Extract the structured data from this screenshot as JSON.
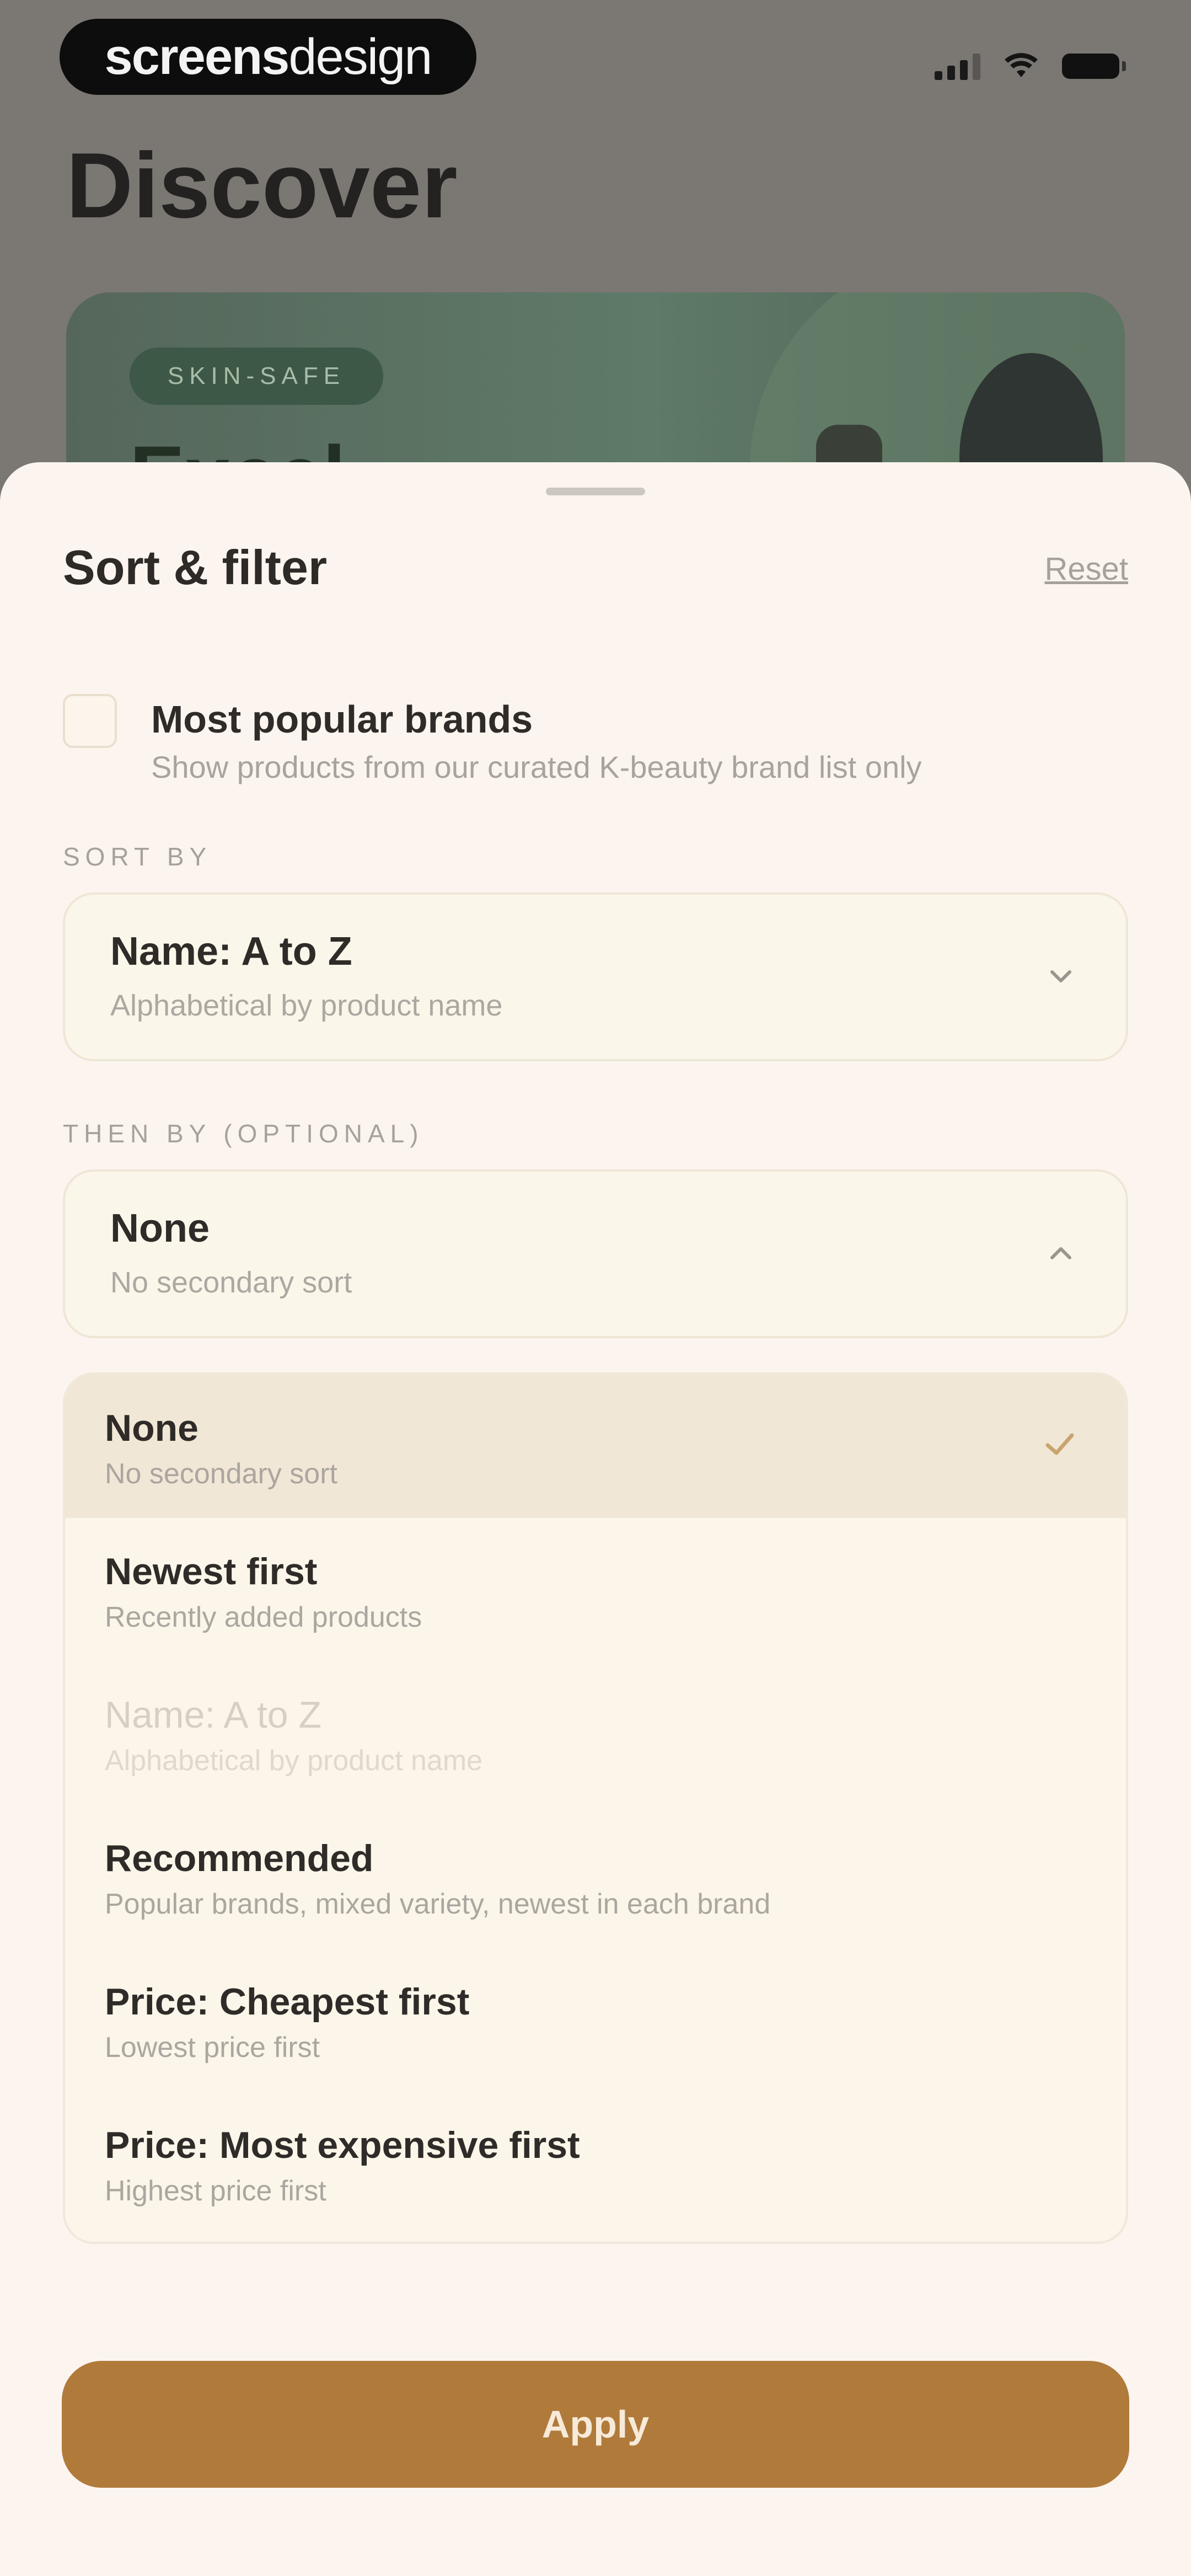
{
  "status_bar": {
    "brand_bold": "screens",
    "brand_light": "design"
  },
  "background": {
    "title": "Discover",
    "hero_tag": "SKIN-SAFE",
    "hero_heading": "Excel...",
    "hero_color": "#5f7a68"
  },
  "sheet": {
    "title": "Sort & filter",
    "reset_label": "Reset",
    "popular": {
      "title": "Most popular brands",
      "subtitle": "Show products from our curated K-beauty brand list only",
      "checked": false
    },
    "sort_by": {
      "label": "SORT BY",
      "value": "Name: A to Z",
      "description": "Alphabetical by product name"
    },
    "then_by": {
      "label": "THEN BY (OPTIONAL)",
      "value": "None",
      "description": "No secondary sort",
      "expanded": true
    },
    "options": [
      {
        "title": "None",
        "subtitle": "No secondary sort",
        "selected": true,
        "disabled": false
      },
      {
        "title": "Newest first",
        "subtitle": "Recently added products",
        "selected": false,
        "disabled": false
      },
      {
        "title": "Name: A to Z",
        "subtitle": "Alphabetical by product name",
        "selected": false,
        "disabled": true
      },
      {
        "title": "Recommended",
        "subtitle": "Popular brands, mixed variety, newest in each brand",
        "selected": false,
        "disabled": false
      },
      {
        "title": "Price: Cheapest first",
        "subtitle": "Lowest price first",
        "selected": false,
        "disabled": false
      },
      {
        "title": "Price: Most expensive first",
        "subtitle": "Highest price first",
        "selected": false,
        "disabled": false
      }
    ],
    "apply_label": "Apply"
  },
  "colors": {
    "accent": "#b07a3b",
    "sheet_background": "#fcf5ef",
    "selected_row": "#f1e7d6",
    "checkmark": "#c9a46e"
  }
}
